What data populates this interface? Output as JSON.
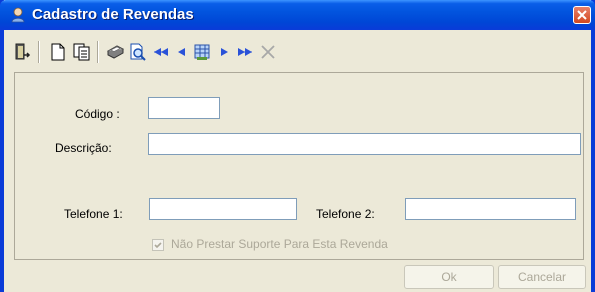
{
  "window": {
    "title": "Cadastro de Revendas",
    "colors": {
      "titlebar": "#0254de",
      "face": "#ece9d8",
      "disabled_text": "#aca899"
    }
  },
  "toolbar": {
    "icons": [
      "exit-door-icon",
      "new-document-icon",
      "copy-document-icon",
      "print-icon",
      "preview-icon",
      "first-record-icon",
      "previous-record-icon",
      "grid-view-icon",
      "next-record-icon",
      "last-record-icon",
      "delete-icon"
    ]
  },
  "form": {
    "codigo_label": "Código :",
    "codigo_value": "",
    "descricao_label": "Descrição:",
    "descricao_value": "",
    "telefone1_label": "Telefone 1:",
    "telefone1_value": "",
    "telefone2_label": "Telefone 2:",
    "telefone2_value": "",
    "nao_suporte_label": "Não Prestar Suporte Para Esta Revenda",
    "nao_suporte_checked": true,
    "nao_suporte_enabled": false
  },
  "buttons": {
    "ok_label": "Ok",
    "cancel_label": "Cancelar"
  }
}
